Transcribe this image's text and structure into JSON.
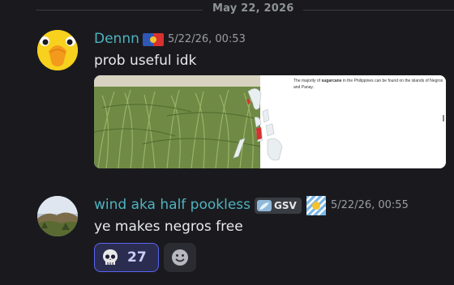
{
  "divider": {
    "date": "May 22, 2026"
  },
  "messages": [
    {
      "author": "Dennn",
      "timestamp": "5/22/26, 00:53",
      "text": "prob useful idk",
      "avatar_icon": "yellow-bird-icon",
      "badge_icon": "flag-badge-icon",
      "embed": {
        "caption_pre": "The majority of ",
        "caption_bold": "sugarcane",
        "caption_post": " in the Philippines can be found on the islands of Negros and Panay.",
        "map_icon": "philippines-map-icon"
      }
    },
    {
      "author": "wind aka half pookless",
      "timestamp": "5/22/26, 00:55",
      "text": "ye makes negros free",
      "avatar_icon": "landscape-avatar-icon",
      "tag": {
        "icon": "feather-icon",
        "label": "GSV"
      },
      "badge_icon": "striped-badge-icon",
      "reactions": [
        {
          "emoji": "skull-icon",
          "count": "27"
        }
      ]
    }
  ],
  "colors": {
    "accent": "#4fb3bf",
    "reaction_border": "#5865f2",
    "background": "#1a1a1e"
  }
}
